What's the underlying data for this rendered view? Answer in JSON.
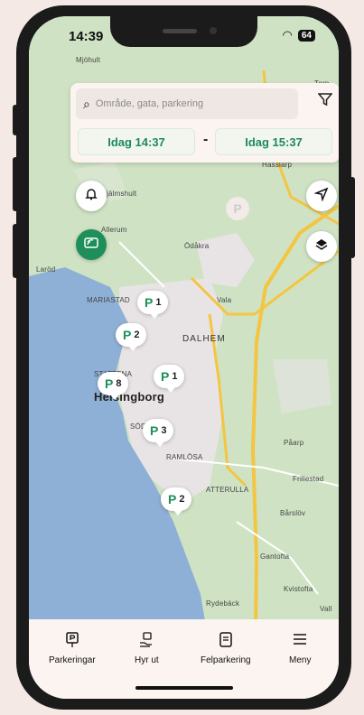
{
  "status_bar": {
    "time": "14:39",
    "battery": "64"
  },
  "search": {
    "placeholder": "Område, gata, parkering",
    "time_from": "Idag 14:37",
    "time_separator": "-",
    "time_to": "Idag 15:37"
  },
  "map": {
    "labels": [
      "Mjöhult",
      "Torp",
      "Hasslarp",
      "Hjälmshult",
      "Allerum",
      "Ödåkra",
      "Laröd",
      "MARIASTAD",
      "Vala",
      "DALHEM",
      "STATTENA",
      "Helsingborg",
      "SÖDER",
      "RAMLÖSA",
      "Påarp",
      "Frillestad",
      "ATTERULLA",
      "Bårslöv",
      "Gantofta",
      "Rydebäck",
      "Kvistofta",
      "Vall"
    ]
  },
  "pins": [
    {
      "count": "1"
    },
    {
      "count": "2"
    },
    {
      "count": "8"
    },
    {
      "count": "1"
    },
    {
      "count": "3"
    },
    {
      "count": "2"
    }
  ],
  "nav": [
    {
      "label": "Parkeringar",
      "icon": "parking-sign-icon"
    },
    {
      "label": "Hyr ut",
      "icon": "hand-parking-icon"
    },
    {
      "label": "Felparkering",
      "icon": "ticket-icon"
    },
    {
      "label": "Meny",
      "icon": "menu-icon"
    }
  ],
  "colors": {
    "accent": "#1e8f5b",
    "sea": "#8fb0d6",
    "land": "#cfe3c4",
    "urban": "#e8e4e6",
    "road": "#f4c542"
  }
}
